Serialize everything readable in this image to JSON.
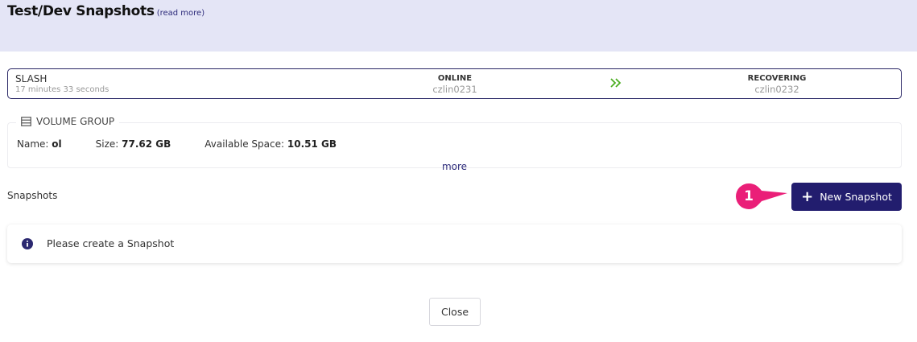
{
  "header": {
    "title": "Test/Dev Snapshots",
    "read_more": "(read more)"
  },
  "status_bar": {
    "name": "SLASH",
    "elapsed": "17 minutes 33 seconds",
    "source_status": "ONLINE",
    "source_host": "czlin0231",
    "target_status": "RECOVERING",
    "target_host": "czlin0232"
  },
  "volume_group": {
    "legend": "VOLUME GROUP",
    "name_label": "Name:",
    "name_value": "ol",
    "size_label": "Size:",
    "size_value": "77.62 GB",
    "available_label": "Available Space:",
    "available_value": "10.51 GB",
    "more_link": "more"
  },
  "snapshots": {
    "label": "Snapshots",
    "new_button_label": "New Snapshot",
    "callout_number": "1",
    "empty_message": "Please create a Snapshot"
  },
  "footer": {
    "close_label": "Close"
  },
  "colors": {
    "header_bg": "#e4e5f6",
    "primary": "#221d6e",
    "accent_green": "#4caf22",
    "callout_pink": "#ea1f78"
  }
}
